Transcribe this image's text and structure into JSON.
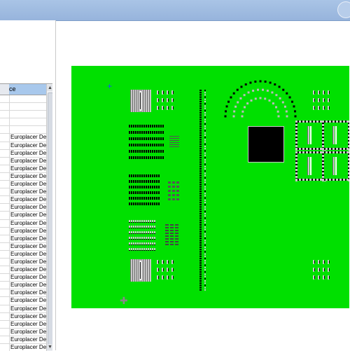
{
  "window": {
    "title": ""
  },
  "grid": {
    "header": {
      "col2": "ce"
    },
    "rows": [
      {
        "label": ""
      },
      {
        "label": ""
      },
      {
        "label": ""
      },
      {
        "label": ""
      },
      {
        "label": ""
      },
      {
        "label": "Europlacer De"
      },
      {
        "label": "Europlacer De"
      },
      {
        "label": "Europlacer De"
      },
      {
        "label": "Europlacer De"
      },
      {
        "label": "Europlacer De"
      },
      {
        "label": "Europlacer De"
      },
      {
        "label": "Europlacer De"
      },
      {
        "label": "Europlacer De"
      },
      {
        "label": "Europlacer De"
      },
      {
        "label": "Europlacer De"
      },
      {
        "label": "Europlacer De"
      },
      {
        "label": "Europlacer De"
      },
      {
        "label": "Europlacer De"
      },
      {
        "label": "Europlacer De"
      },
      {
        "label": "Europlacer De"
      },
      {
        "label": "Europlacer De"
      },
      {
        "label": "Europlacer De"
      },
      {
        "label": "Europlacer De"
      },
      {
        "label": "Europlacer De"
      },
      {
        "label": "Europlacer De"
      },
      {
        "label": "Europlacer De"
      },
      {
        "label": "Europlacer De"
      },
      {
        "label": "Europlacer De"
      },
      {
        "label": "Europlacer De"
      },
      {
        "label": "Europlacer De"
      },
      {
        "label": "Europlacer De"
      },
      {
        "label": "Europlacer De"
      },
      {
        "label": "Europlacer De"
      }
    ]
  },
  "board": {
    "color": "#00e000"
  },
  "scroll": {
    "up_icon": "arrow-up-icon",
    "down_icon": "arrow-down-icon"
  }
}
